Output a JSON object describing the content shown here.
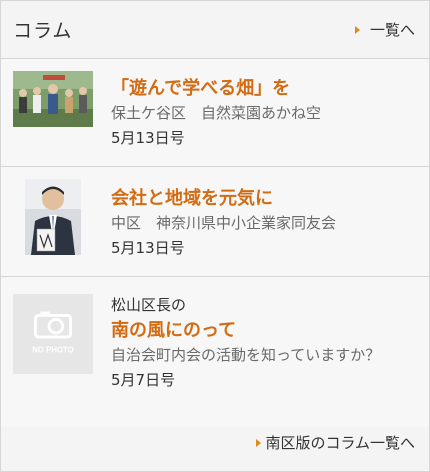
{
  "header": {
    "title": "コラム",
    "link_label": "一覧へ"
  },
  "items": [
    {
      "title": "「遊んで学べる畑」を",
      "subtitle": "保土ケ谷区　自然菜園あかね空",
      "date": "5月13日号",
      "thumb_icon": "photo-people-field"
    },
    {
      "title": "会社と地域を元気に",
      "subtitle": "中区　神奈川県中小企業家同友会",
      "date": "5月13日号",
      "thumb_icon": "photo-portrait-man"
    },
    {
      "pretitle": "松山区長の",
      "title": "南の風にのって",
      "subtitle": "自治会町内会の活動を知っていますか？",
      "date": "5月7日号",
      "thumb_icon": "no-photo-placeholder",
      "thumb_text": "NO PHOTO"
    }
  ],
  "footer": {
    "link_label": "南区版のコラム一覧へ"
  },
  "colors": {
    "accent": "#d36b12",
    "arrow": "#e08a1e",
    "border": "#d6d6d6",
    "background": "#f4f4f4"
  }
}
